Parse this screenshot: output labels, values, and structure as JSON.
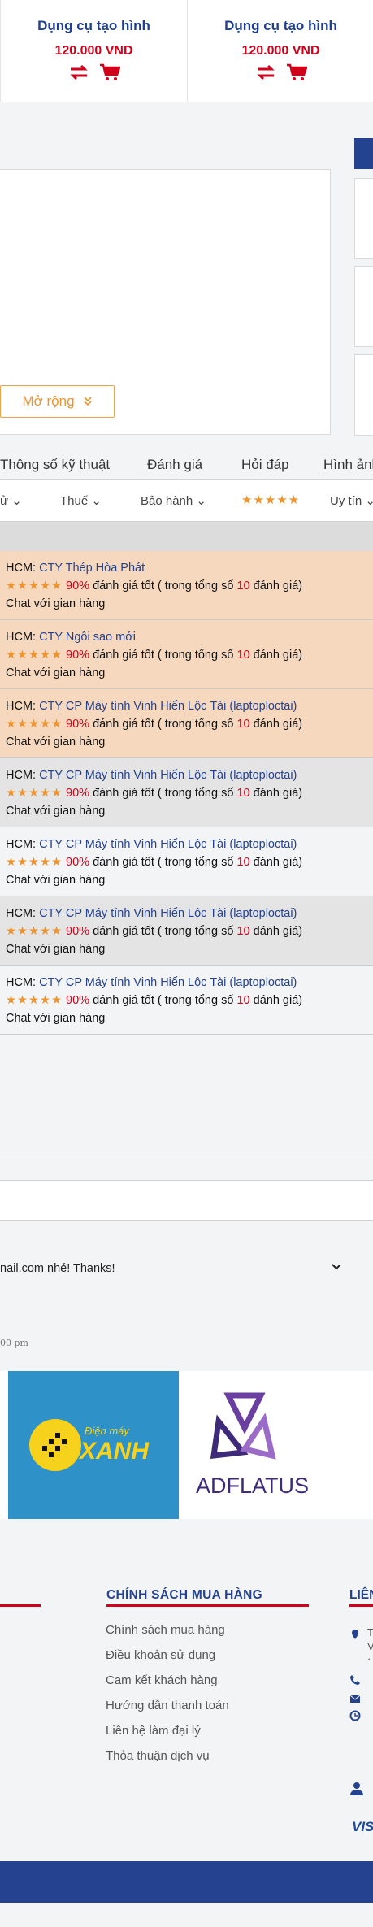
{
  "related_products": [
    {
      "name": "Dụng cụ tạo hình",
      "price": "120.000 VND"
    },
    {
      "name": "Dụng cụ tạo hình",
      "price": "120.000 VND"
    }
  ],
  "description": {
    "expand_label": "Mở rộng",
    "expand_icon": "double-chevron-down-icon"
  },
  "tabs": [
    "Thông số kỹ thuật",
    "Đánh giá",
    "Hỏi đáp",
    "Hình ảnh"
  ],
  "filters": {
    "item1": "ử",
    "item2": "Thuế",
    "item3": "Bảo hành",
    "stars": "★★★★★",
    "item5": "Uy tín"
  },
  "sellers": [
    {
      "region": "HCM:",
      "company": "CTY Thép Hòa Phát",
      "stars": "★★★★★",
      "percent": "90%",
      "rating_text": "đánh giá tốt ( trong tổng số",
      "count": "10",
      "rating_suffix": "đánh giá)",
      "chat": "Chat với gian hàng"
    },
    {
      "region": "HCM:",
      "company": "CTY Ngôi sao mới",
      "stars": "★★★★★",
      "percent": "90%",
      "rating_text": "đánh giá tốt ( trong tổng số",
      "count": "10",
      "rating_suffix": "đánh giá)",
      "chat": "Chat với gian hàng"
    },
    {
      "region": "HCM:",
      "company": "CTY CP Máy tính Vinh Hiển Lộc Tài (laptoploctai)",
      "stars": "★★★★★",
      "percent": "90%",
      "rating_text": "đánh giá tốt ( trong tổng số",
      "count": "10",
      "rating_suffix": "đánh giá)",
      "chat": "Chat với gian hàng"
    },
    {
      "region": "HCM:",
      "company": "CTY CP Máy tính Vinh Hiển Lộc Tài (laptoploctai)",
      "stars": "★★★★★",
      "percent": "90%",
      "rating_text": "đánh giá tốt ( trong tổng số",
      "count": "10",
      "rating_suffix": "đánh giá)",
      "chat": "Chat với gian hàng"
    },
    {
      "region": "HCM:",
      "company": "CTY CP Máy tính Vinh Hiển Lộc Tài (laptoploctai)",
      "stars": "★★★★★",
      "percent": "90%",
      "rating_text": "đánh giá tốt ( trong tổng số",
      "count": "10",
      "rating_suffix": "đánh giá)",
      "chat": "Chat với gian hàng"
    },
    {
      "region": "HCM:",
      "company": "CTY CP Máy tính Vinh Hiển Lộc Tài (laptoploctai)",
      "stars": "★★★★★",
      "percent": "90%",
      "rating_text": "đánh giá tốt ( trong tổng số",
      "count": "10",
      "rating_suffix": "đánh giá)",
      "chat": "Chat với gian hàng"
    },
    {
      "region": "HCM:",
      "company": "CTY CP Máy tính Vinh Hiển Lộc Tài (laptoploctai)",
      "stars": "★★★★★",
      "percent": "90%",
      "rating_text": "đánh giá tốt ( trong tổng số",
      "count": "10",
      "rating_suffix": "đánh giá)",
      "chat": "Chat với gian hàng"
    }
  ],
  "faq": {
    "question": "nail.com nhé! Thanks!",
    "time": "00 pm"
  },
  "partners": [
    {
      "name": "Điện máy XANH",
      "brand_top": "Điện máy",
      "brand_main": "XANH"
    },
    {
      "name": "ADFLATUS",
      "brand_main": "ADFLATUS"
    }
  ],
  "footer": {
    "policy_title": "CHÍNH SÁCH MUA HÀNG",
    "policy_links": [
      "Chính sách mua hàng",
      "Điều khoản sử dụng",
      "Cam kết khách hàng",
      "Hướng dẫn thanh toán",
      "Liên hệ làm đại lý",
      "Thỏa thuận dịch vụ"
    ],
    "contact_title": "LIÊN",
    "contact_fragments": [
      "T",
      "V",
      "·"
    ],
    "payment": "VIS"
  },
  "colors": {
    "brand_blue": "#24428f",
    "accent_orange": "#f0932b",
    "price_red": "#d0021b"
  }
}
